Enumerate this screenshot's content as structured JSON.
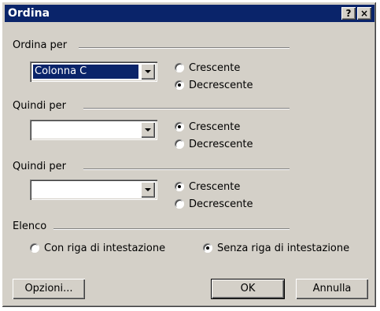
{
  "window": {
    "title": "Ordina",
    "help_icon": "?",
    "close_icon": "×"
  },
  "sections": [
    {
      "label": "Ordina per",
      "combo_value": "Colonna C",
      "radios": [
        {
          "label": "Crescente",
          "checked": false
        },
        {
          "label": "Decrescente",
          "checked": true
        }
      ]
    },
    {
      "label": "Quindi per",
      "combo_value": "",
      "radios": [
        {
          "label": "Crescente",
          "checked": true
        },
        {
          "label": "Decrescente",
          "checked": false
        }
      ]
    },
    {
      "label": "Quindi per",
      "combo_value": "",
      "radios": [
        {
          "label": "Crescente",
          "checked": true
        },
        {
          "label": "Decrescente",
          "checked": false
        }
      ]
    }
  ],
  "elenco": {
    "label": "Elenco",
    "options": [
      {
        "label": "Con riga di intestazione",
        "checked": false
      },
      {
        "label": "Senza riga di intestazione",
        "checked": true
      }
    ]
  },
  "buttons": {
    "options": "Opzioni...",
    "ok": "OK",
    "cancel": "Annulla"
  }
}
